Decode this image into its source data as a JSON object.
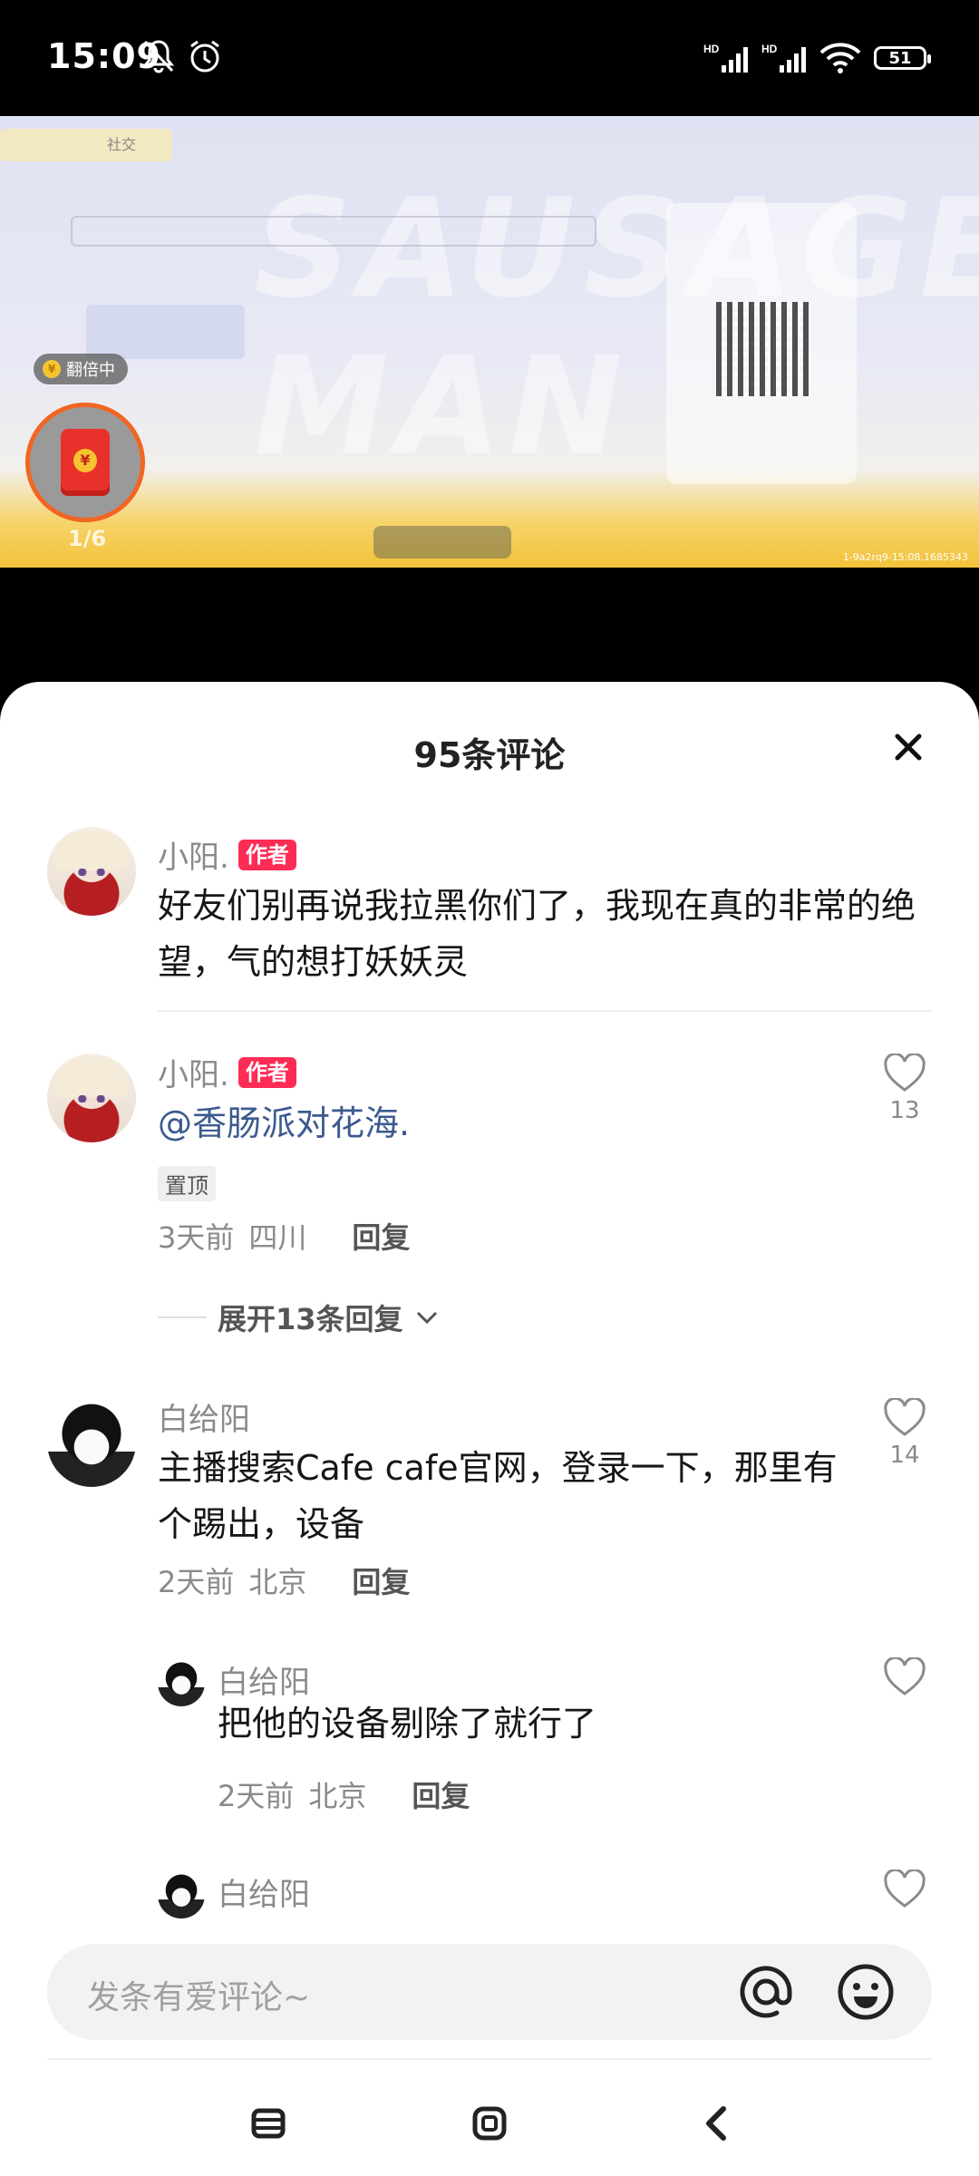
{
  "status_bar": {
    "time": "15:09",
    "icons": [
      "mute-bell-icon",
      "alarm-icon",
      "signal-hd-icon",
      "signal-hd-icon",
      "wifi-icon",
      "battery-icon"
    ],
    "battery": "51",
    "signal_label": "HD"
  },
  "video": {
    "watermark": "SAUSAGE MAN",
    "red_packet_badge": "翻倍中",
    "page_indicator": "1/6",
    "tab_label": "社交",
    "id_text": "1-9a2rq9-15:08.1685343"
  },
  "sheet": {
    "title": "95条评论"
  },
  "comments": [
    {
      "author": "小阳.",
      "author_tag": "作者",
      "text": "好友们别再说我拉黑你们了，我现在真的非常的绝望，气的想打妖妖灵"
    },
    {
      "author": "小阳.",
      "author_tag": "作者",
      "text": "@香肠派对花海.",
      "pin": "置顶",
      "time": "3天前",
      "location": "四川",
      "reply": "回复",
      "likes": "13",
      "expand": "展开13条回复"
    },
    {
      "author": "白给阳",
      "text": "主播搜索Cafe cafe官网，登录一下，那里有个踢出，设备",
      "time": "2天前",
      "location": "北京",
      "reply": "回复",
      "likes": "14"
    }
  ],
  "replies": [
    {
      "author": "白给阳",
      "text": "把他的设备剔除了就行了",
      "time": "2天前",
      "location": "北京",
      "reply": "回复"
    },
    {
      "author": "白给阳"
    }
  ],
  "input": {
    "placeholder": "发条有爱评论~"
  },
  "colors": {
    "author_tag": "#fe2c55",
    "mention": "#3c5a8f",
    "red_packet_ring": "#f26522"
  }
}
